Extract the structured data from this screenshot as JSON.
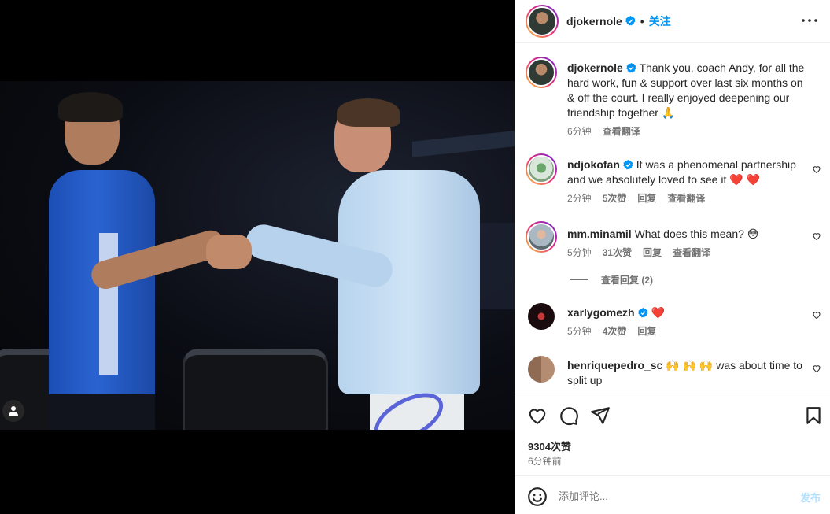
{
  "post": {
    "username": "djokernole",
    "follow_label": "关注",
    "dot": "•"
  },
  "caption": {
    "username": "djokernole",
    "text": "Thank you, coach Andy, for all the hard work, fun & support over last six months on & off the court. I really enjoyed deepening our friendship together 🙏",
    "time": "6分钟",
    "translate": "查看翻译"
  },
  "comments": [
    {
      "username": "ndjokofan",
      "text": "It was a phenomenal partnership and we absolutely loved to see it ❤️ ❤️",
      "time": "2分钟",
      "likes": "5次赞",
      "reply": "回复",
      "translate": "查看翻译"
    },
    {
      "username": "mm.minamil",
      "text": "What does this mean? 😳",
      "time": "5分钟",
      "likes": "31次赞",
      "reply": "回复",
      "translate": "查看翻译"
    },
    {
      "username": "xarlygomezh",
      "text": "❤️",
      "time": "5分钟",
      "likes": "4次赞",
      "reply": "回复"
    },
    {
      "username": "henriquepedro_sc",
      "text": "🙌 🙌 🙌 was about time to split up"
    }
  ],
  "view_replies": "查看回复 (2)",
  "likes_total": "9304次赞",
  "post_time": "6分钟前",
  "add_comment": {
    "placeholder": "添加评论...",
    "post_label": "发布"
  },
  "icons": {
    "more": "more-icon",
    "heart": "heart-icon",
    "comment": "comment-icon",
    "share": "share-icon",
    "save": "bookmark-icon",
    "emoji": "emoji-icon",
    "tag": "user-tag-icon",
    "verified": "verified-badge-icon"
  },
  "colors": {
    "accent": "#0095f6",
    "verified": "#0095f6",
    "heart_emoji": "#ed4956"
  }
}
